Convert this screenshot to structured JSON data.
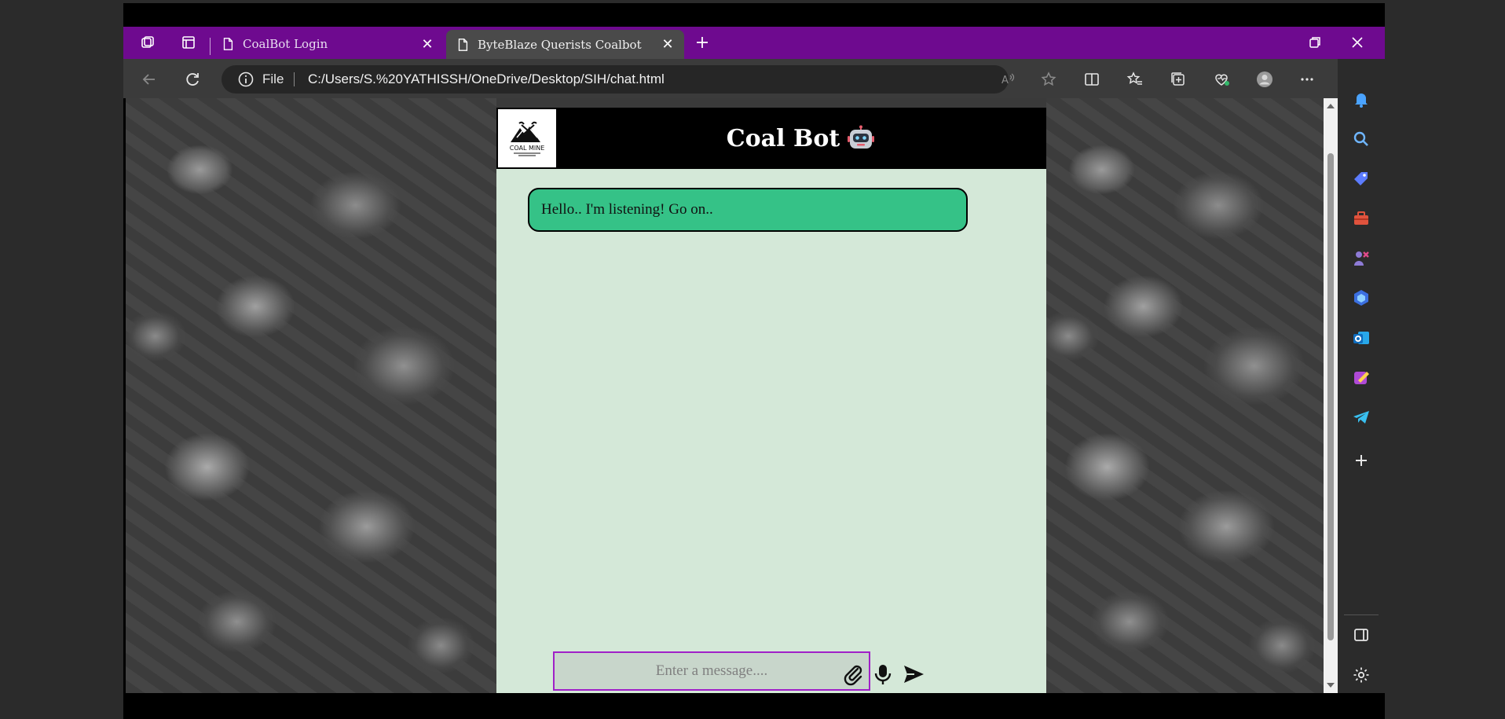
{
  "browser": {
    "tabs": [
      {
        "label": "CoalBot Login",
        "active": false
      },
      {
        "label": "ByteBlaze Querists Coalbot",
        "active": true
      }
    ],
    "address": {
      "scheme_label": "File",
      "url": "C:/Users/S.%20YATHISSH/OneDrive/Desktop/SIH/chat.html"
    },
    "colors": {
      "tabstrip": "#6e0a8f",
      "toolbar": "#3b3b3b"
    }
  },
  "chat": {
    "title": "Coal Bot",
    "logo_text": "COAL MINE",
    "messages": [
      {
        "from": "bot",
        "text": "Hello.. I'm listening! Go on.."
      }
    ],
    "input": {
      "placeholder": "Enter a message....",
      "value": ""
    },
    "colors": {
      "panel": "#d4e8d8",
      "bot_bubble": "#35c287",
      "input_border": "#a020c8"
    }
  },
  "icons": {
    "tabbar": [
      "workspaces-icon",
      "tab-actions-icon",
      "page-icon",
      "close-icon",
      "new-tab-icon",
      "restore-icon",
      "window-close-icon"
    ],
    "toolbar": [
      "back-icon",
      "refresh-icon",
      "info-icon",
      "read-aloud-icon",
      "favorite-star-icon",
      "split-screen-icon",
      "favorites-icon",
      "collections-icon",
      "browser-essentials-icon",
      "profile-icon",
      "more-icon",
      "bing-copilot-icon"
    ],
    "sidebar": [
      "bell-icon",
      "search-icon",
      "shopping-tag-icon",
      "tools-icon",
      "games-icon",
      "microsoft365-icon",
      "outlook-icon",
      "designer-icon",
      "telegram-icon",
      "add-icon",
      "hide-sidebar-icon",
      "settings-icon"
    ],
    "chat_actions": [
      "attach-icon",
      "microphone-icon",
      "send-icon"
    ]
  }
}
